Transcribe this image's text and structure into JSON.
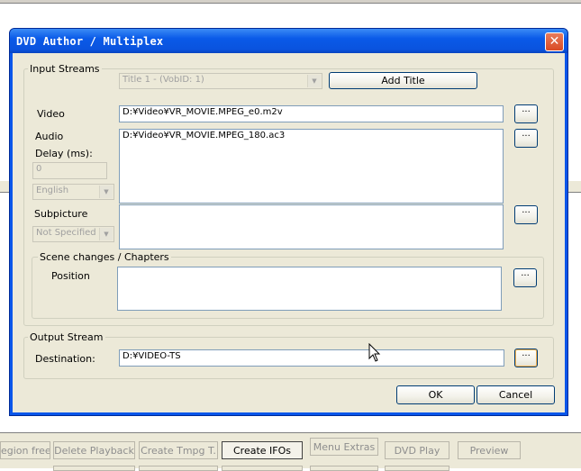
{
  "background": {
    "bottom_buttons": [
      {
        "label": "egion free",
        "active": false
      },
      {
        "label": "Delete Playback",
        "active": false
      },
      {
        "label": "Create Tmpg T.",
        "active": false
      },
      {
        "label": "Create IFOs",
        "active": true
      },
      {
        "label": "Menu Extras",
        "active": false
      },
      {
        "label": "DVD Play",
        "active": false
      },
      {
        "label": "Preview",
        "active": false
      }
    ]
  },
  "dialog": {
    "title": "DVD Author / Multiplex",
    "close_glyph": "✕",
    "input_streams": {
      "group_label": "Input Streams",
      "title_select": "Title 1 - (VobID: 1)",
      "add_title_label": "Add Title",
      "video_label": "Video",
      "video_value": "D:¥Video¥VR_MOVIE.MPEG_e0.m2v",
      "audio_label": "Audio",
      "audio_value": "D:¥Video¥VR_MOVIE.MPEG_180.ac3",
      "delay_label": "Delay (ms):",
      "delay_value": "0",
      "language_value": "English",
      "subpicture_label": "Subpicture",
      "subpicture_select": "Not Specified",
      "browse_label": "..."
    },
    "scene_changes": {
      "group_label": "Scene changes / Chapters",
      "position_label": "Position"
    },
    "output_stream": {
      "group_label": "Output Stream",
      "destination_label": "Destination:",
      "destination_value": "D:¥VIDEO-TS",
      "browse_label": "..."
    },
    "ok_label": "OK",
    "cancel_label": "Cancel"
  }
}
